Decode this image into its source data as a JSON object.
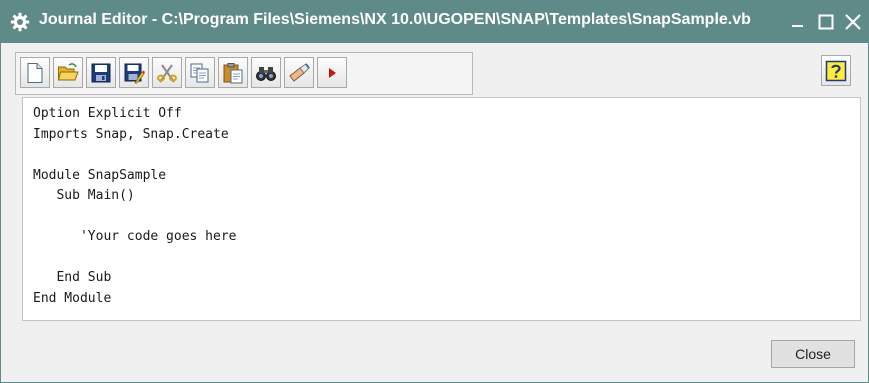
{
  "window": {
    "title": "Journal Editor - C:\\Program Files\\Siemens\\NX 10.0\\UGOPEN\\SNAP\\Templates\\SnapSample.vb",
    "titlebar_color": "#5e8b88",
    "title_icon": "gear-icon",
    "controls": {
      "minimize_icon": "minimize-icon",
      "maximize_icon": "maximize-icon",
      "close_icon": "close-icon"
    }
  },
  "toolbar": {
    "buttons": [
      {
        "id": "new",
        "icon": "new-file-icon"
      },
      {
        "id": "open",
        "icon": "open-folder-icon"
      },
      {
        "id": "save",
        "icon": "save-icon"
      },
      {
        "id": "save-as",
        "icon": "save-as-icon"
      },
      {
        "id": "cut",
        "icon": "scissors-icon"
      },
      {
        "id": "copy",
        "icon": "copy-icon"
      },
      {
        "id": "paste",
        "icon": "paste-icon"
      },
      {
        "id": "find",
        "icon": "binoculars-icon"
      },
      {
        "id": "replace",
        "icon": "eraser-icon"
      },
      {
        "id": "run",
        "icon": "play-icon",
        "color": "#cc1111"
      }
    ],
    "help_icon": "help-icon"
  },
  "editor": {
    "code": "Option Explicit Off\nImports Snap, Snap.Create\n\nModule SnapSample\n   Sub Main()\n\n      'Your code goes here\n\n   End Sub\nEnd Module"
  },
  "footer": {
    "close_label": "Close"
  }
}
